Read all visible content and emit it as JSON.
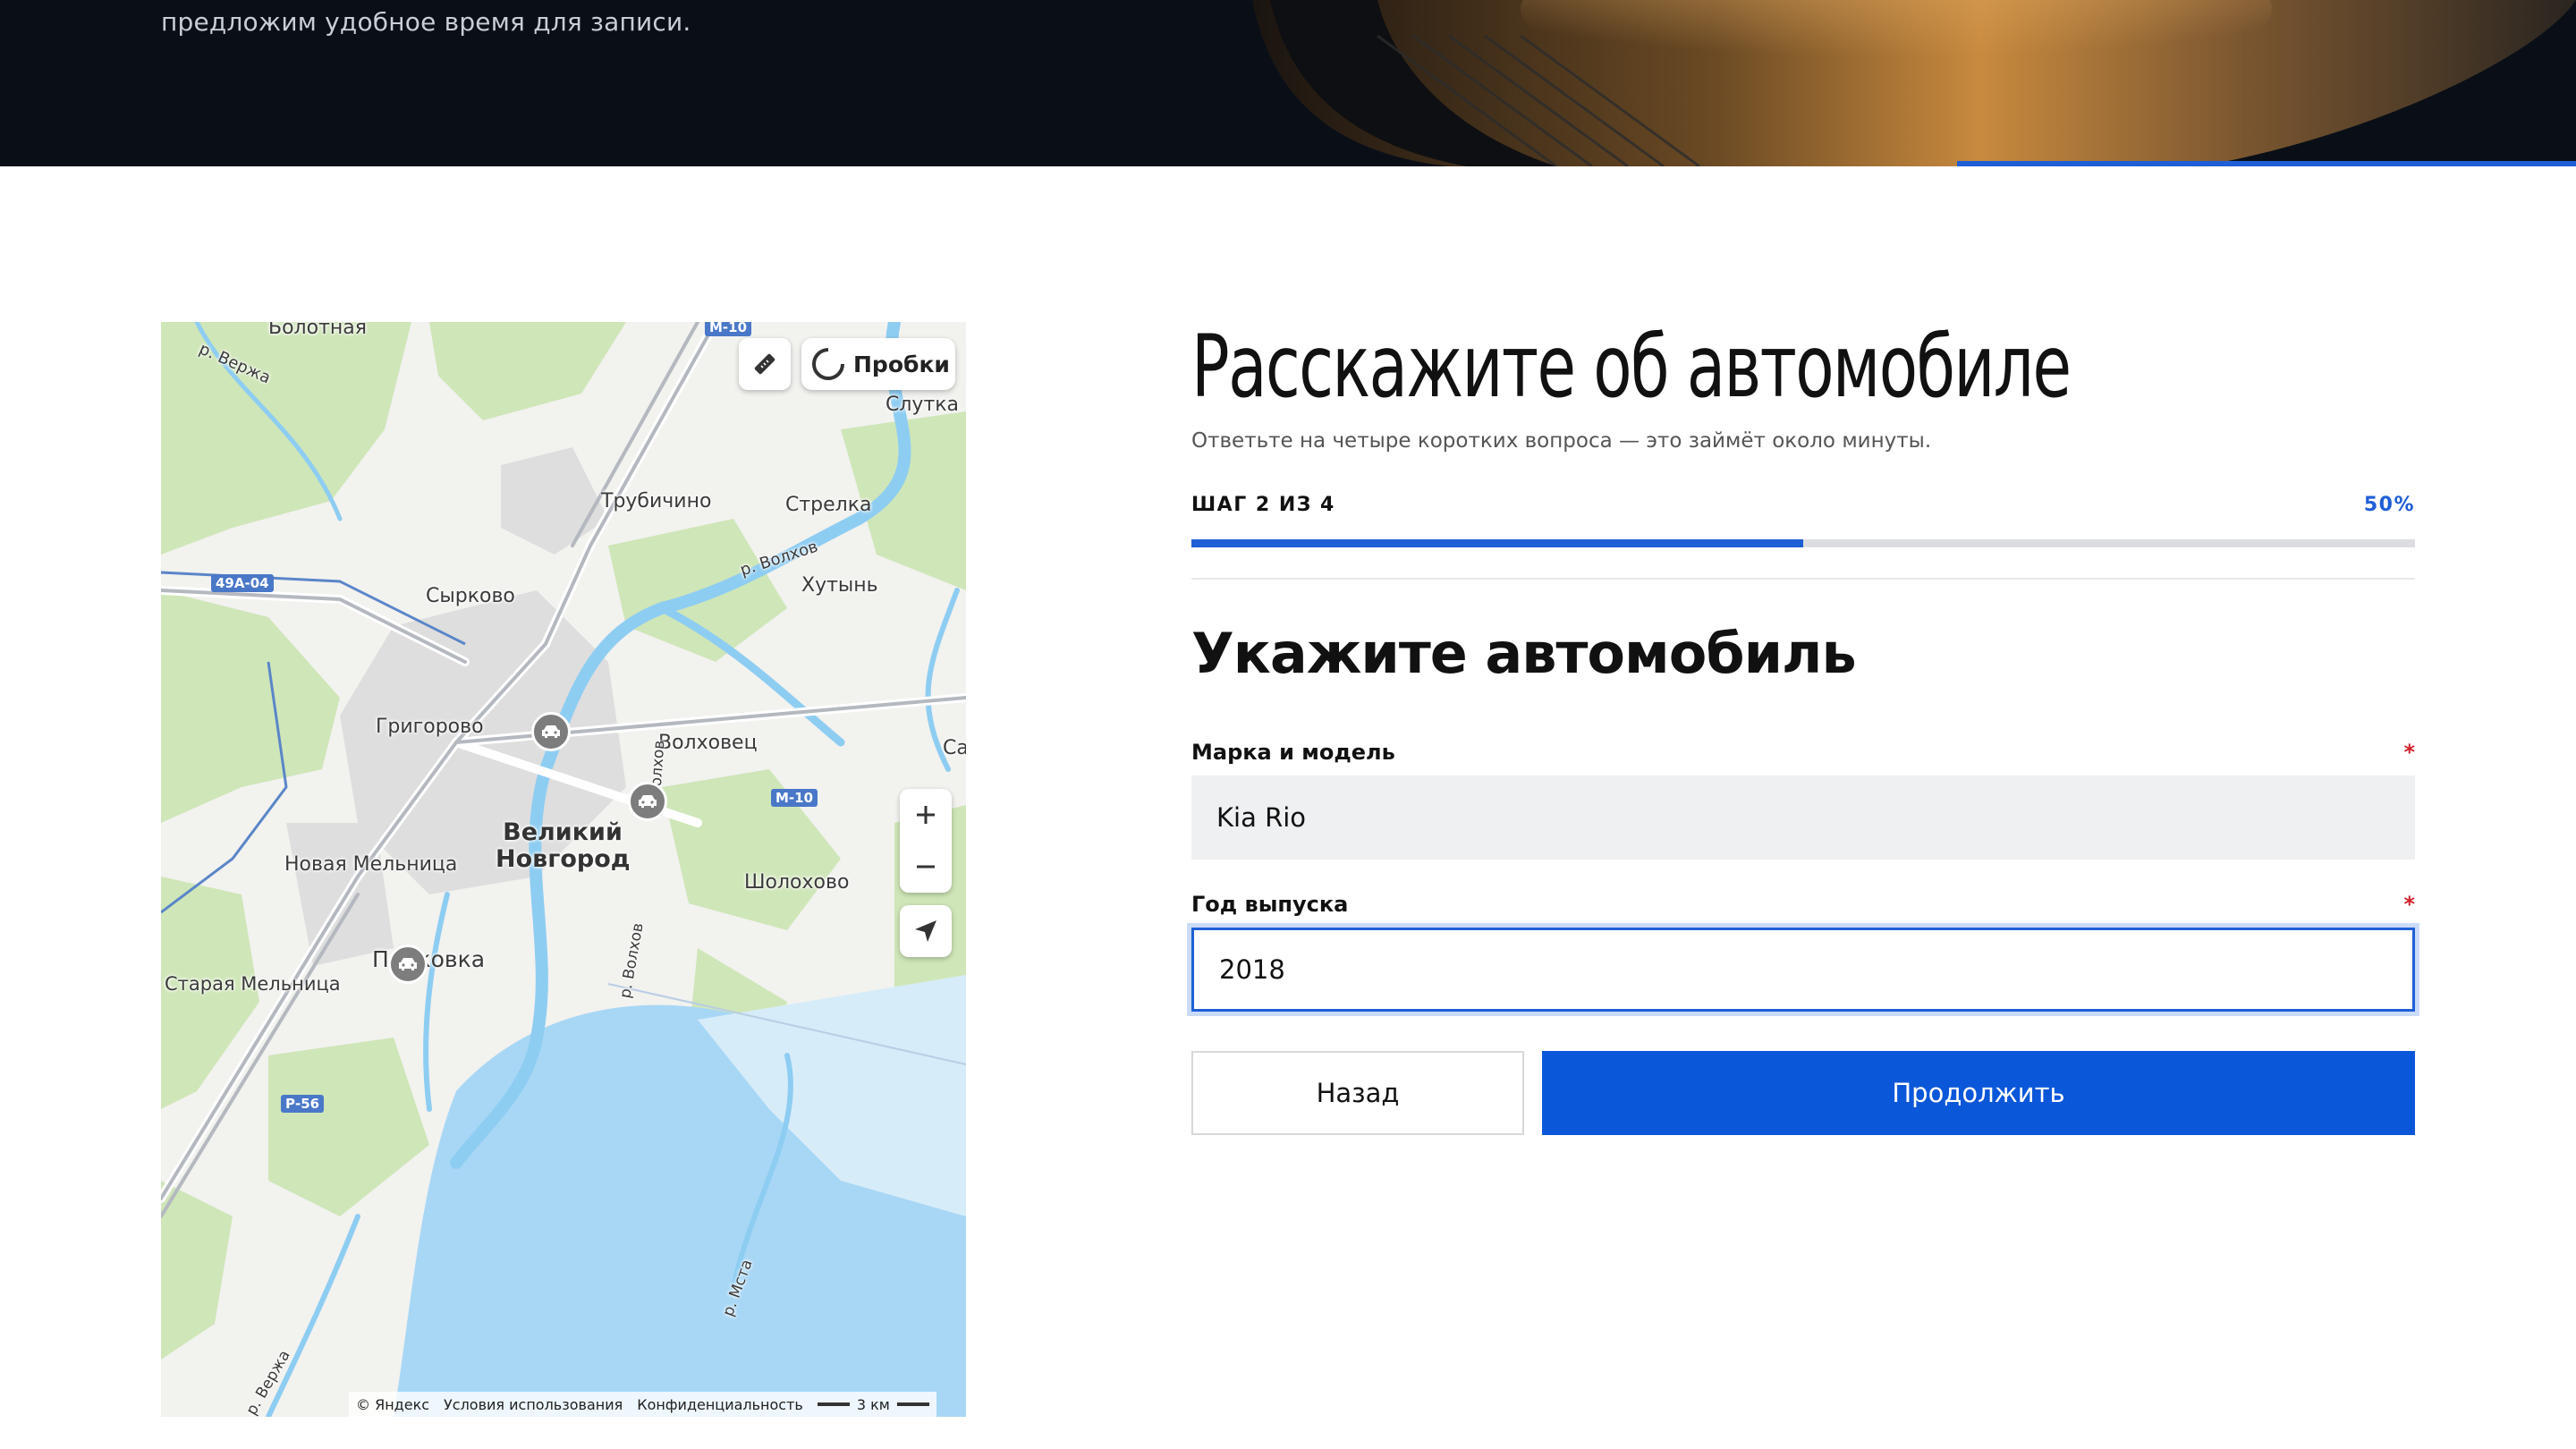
{
  "hero": {
    "text": "предложим удобное время для записи."
  },
  "map": {
    "traffic_label": "Пробки",
    "labels": {
      "bolotnaya": "Болотная",
      "verzha_top": "р. Вержа",
      "slutka": "Слутка",
      "trubichino": "Трубичино",
      "strelka": "Стрелка",
      "volkhov_river": "р. Волхов",
      "khutyn": "Хутынь",
      "syrkovo": "Сырково",
      "grigorovo": "Григорово",
      "volkhovets": "Волховец",
      "sa": "Са",
      "veliky_novgorod": "Великий Новгород",
      "novaya_melnitsa": "Новая Мельница",
      "sholokhovo": "Шолохово",
      "pankovka": "Панковка",
      "staraya_melnitsa": "Старая Мельница",
      "volkhov_river2": "р. Волхов",
      "volkhov_river3": "р. Волхов",
      "msta_river": "р. Мста",
      "verzha_bottom": "р. Вержа"
    },
    "road_badges": {
      "r49a04": "49А-04",
      "m10": "М-10",
      "m10_top": "М-10",
      "p56": "Р-56"
    },
    "footer": {
      "brand": "© Яндекс",
      "terms": "Условия использования",
      "privacy": "Конфиденциальность",
      "scale": "3 км"
    }
  },
  "form": {
    "title": "Расскажите об автомобиле",
    "subtitle": "Ответьте на четыре коротких вопроса — это займёт около минуты.",
    "step_text": "ШАГ 2 ИЗ 4",
    "progress_percent_label": "50%",
    "progress_fraction": 0.5,
    "section_title": "Укажите автомобиль",
    "fields": {
      "make_model": {
        "label": "Марка и модель",
        "required_mark": "*",
        "value": "Kia Rio"
      },
      "year": {
        "label": "Год выпуска",
        "required_mark": "*",
        "value": "2018"
      }
    },
    "buttons": {
      "back": "Назад",
      "next": "Продолжить"
    }
  },
  "colors": {
    "accent": "#1f5fd6",
    "primary_button": "#0b57d9",
    "required": "#d2232a",
    "hero_bg": "#0a0f17"
  },
  "icons": [
    "ruler-icon",
    "traffic-icon",
    "plus-icon",
    "minus-icon",
    "location-arrow-icon",
    "car-marker-icon"
  ]
}
